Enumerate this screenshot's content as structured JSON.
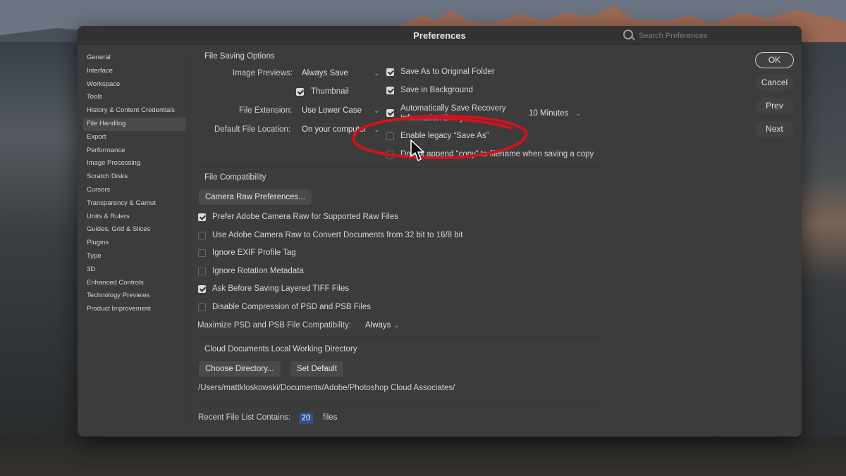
{
  "window": {
    "title": "Preferences"
  },
  "search": {
    "placeholder": "Search Preferences"
  },
  "sidebar": {
    "active": "File Handling",
    "items": [
      {
        "label": "General"
      },
      {
        "label": "Interface"
      },
      {
        "label": "Workspace"
      },
      {
        "label": "Tools"
      },
      {
        "label": "History & Content Credentials"
      },
      {
        "label": "File Handling"
      },
      {
        "label": "Export"
      },
      {
        "label": "Performance"
      },
      {
        "label": "Image Processing"
      },
      {
        "label": "Scratch Disks"
      },
      {
        "label": "Cursors"
      },
      {
        "label": "Transparency & Gamut"
      },
      {
        "label": "Units & Rulers"
      },
      {
        "label": "Guides, Grid & Slices"
      },
      {
        "label": "Plugins"
      },
      {
        "label": "Type"
      },
      {
        "label": "3D"
      },
      {
        "label": "Enhanced Controls"
      },
      {
        "label": "Technology Previews"
      },
      {
        "label": "Product Improvement"
      }
    ]
  },
  "file_saving": {
    "title": "File Saving Options",
    "image_previews_label": "Image Previews:",
    "image_previews_value": "Always Save",
    "thumbnail_label": "Thumbnail",
    "thumbnail_checked": true,
    "file_extension_label": "File Extension:",
    "file_extension_value": "Use Lower Case",
    "default_location_label": "Default File Location:",
    "default_location_value": "On your computer",
    "save_original_label": "Save As to Original Folder",
    "save_original_checked": true,
    "save_background_label": "Save in Background",
    "save_background_checked": true,
    "auto_save_label_line1": "Automatically Save Recovery",
    "auto_save_label_line2": "Information Every:",
    "auto_save_checked": true,
    "auto_save_interval": "10 Minutes",
    "legacy_save_label": "Enable legacy “Save As”",
    "legacy_save_checked": false,
    "no_copy_label": "Do not append “copy” to filename when saving a copy",
    "no_copy_checked": false
  },
  "compat": {
    "title": "File Compatibility",
    "camera_raw_button": "Camera Raw Preferences...",
    "options": [
      {
        "label": "Prefer Adobe Camera Raw for Supported Raw Files",
        "checked": true
      },
      {
        "label": "Use Adobe Camera Raw to Convert Documents from 32 bit to 16/8 bit",
        "checked": false
      },
      {
        "label": "Ignore EXIF Profile Tag",
        "checked": false
      },
      {
        "label": "Ignore Rotation Metadata",
        "checked": false
      },
      {
        "label": "Ask Before Saving Layered TIFF Files",
        "checked": true
      },
      {
        "label": "Disable Compression of PSD and PSB Files",
        "checked": false
      }
    ],
    "maximize_label": "Maximize PSD and PSB File Compatibility:",
    "maximize_value": "Always"
  },
  "cloud": {
    "title": "Cloud Documents Local Working Directory",
    "choose_button": "Choose Directory...",
    "default_button": "Set Default",
    "path": "/Users/mattkloskowski/Documents/Adobe/Photoshop Cloud Associates/"
  },
  "recent": {
    "label": "Recent File List Contains:",
    "value": "20",
    "suffix": "files"
  },
  "actions": {
    "ok": "OK",
    "cancel": "Cancel",
    "prev": "Prev",
    "next": "Next"
  },
  "colors": {
    "annotation": "#d3121e",
    "accent_field": "#2f4e8a",
    "window_bg": "#3c3c3c"
  }
}
